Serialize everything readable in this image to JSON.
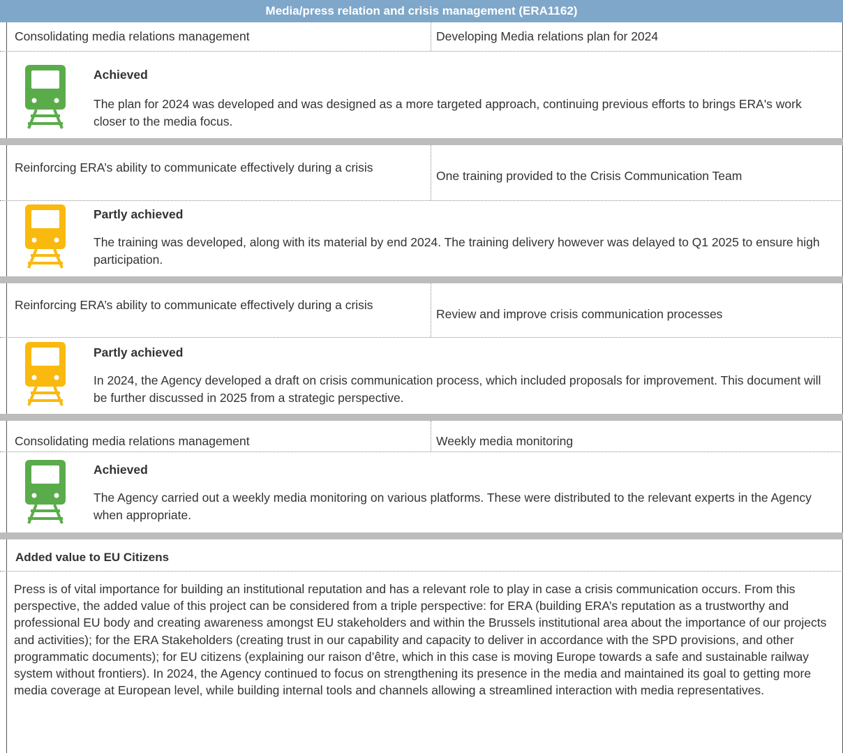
{
  "header": {
    "title": "Media/press relation and crisis management (ERA1162)"
  },
  "colors": {
    "header_bg": "#7fa7c9",
    "achieved": "#5aac4a",
    "partly_achieved": "#f9b90f",
    "separator": "#bcbcbc"
  },
  "items": [
    {
      "objective": "Consolidating media relations management",
      "output": "Developing Media relations plan for 2024",
      "icon": "train-icon",
      "status": "Achieved",
      "description": "The plan for 2024 was developed and was designed as a more targeted approach, continuing previous efforts to brings ERA's work closer to the media focus."
    },
    {
      "objective": "Reinforcing ERA’s ability to communicate effectively during a crisis",
      "output": "One training provided to the Crisis Communication Team",
      "icon": "train-icon",
      "status": "Partly achieved",
      "description": "The training was developed, along with its material by end 2024. The training delivery however was delayed to Q1 2025 to ensure high participation."
    },
    {
      "objective": "Reinforcing ERA’s ability to communicate effectively during a crisis",
      "output": "Review and improve crisis communication processes",
      "icon": "train-icon",
      "status": "Partly achieved",
      "description": "In 2024, the Agency developed a draft on crisis communication process, which included proposals for improvement. This document will be further discussed in 2025 from a strategic perspective."
    },
    {
      "objective": "Consolidating media relations management",
      "output": "Weekly media monitoring",
      "icon": "train-icon",
      "status": "Achieved",
      "description": "The Agency carried out a weekly media monitoring on various platforms. These were distributed to the relevant experts in the Agency when appropriate."
    }
  ],
  "added_value": {
    "title": "Added value to EU Citizens",
    "text": "Press is of vital importance for building an institutional reputation and has a relevant role to play in case a crisis communication occurs. From this perspective, the added value of this project can be considered from a triple perspective: for ERA (building ERA’s reputation as a trustworthy and professional EU body and creating awareness amongst EU stakeholders and within the Brussels institutional area about the importance of our projects and activities); for the ERA Stakeholders (creating trust in our capability and capacity to deliver in accordance with the SPD provisions, and other programmatic documents); for EU citizens (explaining our raison d’être, which in this case is moving Europe towards a safe and sustainable railway system without frontiers). In 2024, the Agency continued to focus on strengthening its presence in the media and maintained its goal to getting more media coverage at European level, while building internal tools and channels allowing a streamlined interaction with media representatives."
  }
}
